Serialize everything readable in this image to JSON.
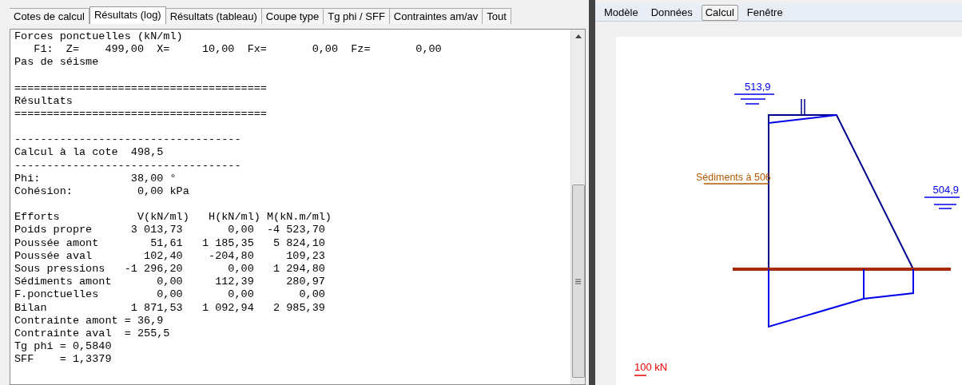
{
  "tabs": [
    {
      "label": "Cotes de calcul",
      "selected": false
    },
    {
      "label": "Résultats (log)",
      "selected": true
    },
    {
      "label": "Résultats (tableau)",
      "selected": false
    },
    {
      "label": "Coupe type",
      "selected": false
    },
    {
      "label": "Tg phi / SFF",
      "selected": false
    },
    {
      "label": "Contraintes am/av",
      "selected": false
    },
    {
      "label": "Tout",
      "selected": false
    }
  ],
  "log": [
    [
      "Forces ponctuelles (kN/ml)",
      "   F1:  Z=    499,00  X=     10,00  Fx=       0,00  Fz=       0,00",
      "Pas de séisme"
    ],
    [
      "=======================================",
      "Résultats",
      "======================================="
    ],
    [
      "-----------------------------------",
      "Calcul à la cote  498,5",
      "-----------------------------------",
      "Phi:              38,00 °",
      "Cohésion:          0,00 kPa"
    ],
    [
      "Efforts            V(kN/ml)   H(kN/ml) M(kN.m/ml)",
      "Poids propre      3 013,73       0,00  -4 523,70",
      "Poussée amont        51,61   1 185,35   5 824,10",
      "Poussée aval        102,40    -204,80     109,23",
      "Sous pressions   -1 296,20       0,00   1 294,80",
      "Sédiments amont       0,00     112,39     280,97",
      "F.ponctuelles         0,00       0,00       0,00",
      "Bilan             1 871,53   1 092,94   2 985,39",
      "Contrainte amont = 36,9",
      "Contrainte aval  = 255,5",
      "Tg phi = 0,5840",
      "SFF    = 1,3379"
    ]
  ],
  "menu": [
    {
      "label": "Modèle",
      "selected": false
    },
    {
      "label": "Données",
      "selected": false
    },
    {
      "label": "Calcul",
      "selected": true
    },
    {
      "label": "Fenêtre",
      "selected": false
    }
  ],
  "diagram": {
    "upstream_level": "513,9",
    "sediment_label": "Sédiments à 506",
    "downstream_level": "504,9",
    "scale_label": "100 kN"
  }
}
